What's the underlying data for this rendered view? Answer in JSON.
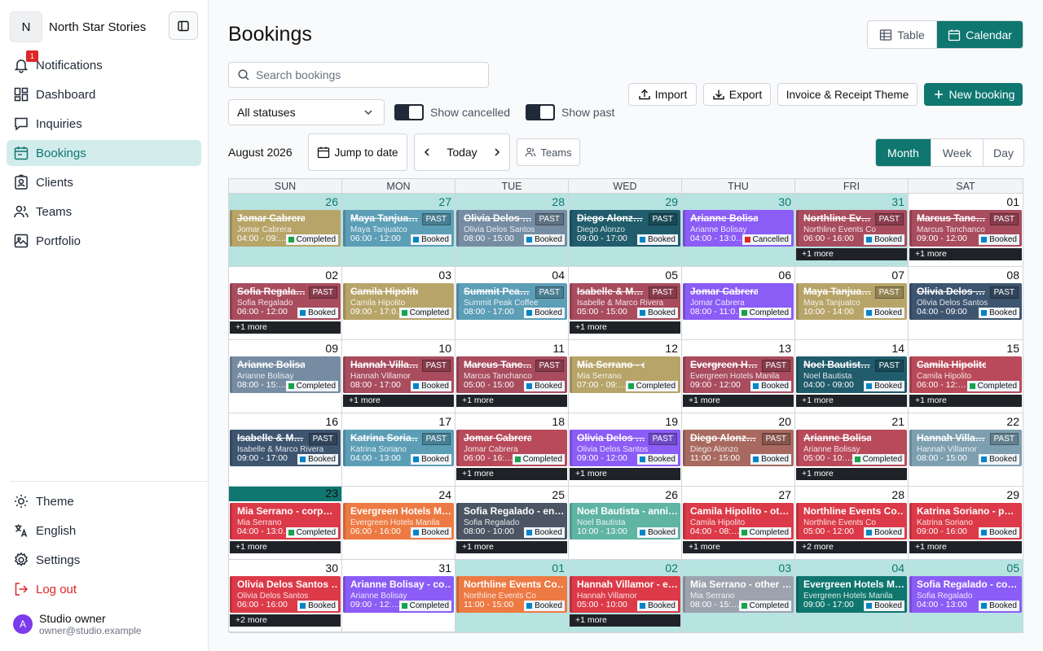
{
  "sidebar": {
    "brand_initial": "N",
    "brand_name": "North Star Stories",
    "notif_badge": "1",
    "items": [
      {
        "label": "Notifications",
        "icon": "bell-icon"
      },
      {
        "label": "Dashboard",
        "icon": "dashboard-icon"
      },
      {
        "label": "Inquiries",
        "icon": "chat-icon"
      },
      {
        "label": "Bookings",
        "icon": "calendar-icon"
      },
      {
        "label": "Clients",
        "icon": "clients-icon"
      },
      {
        "label": "Teams",
        "icon": "users-icon"
      },
      {
        "label": "Portfolio",
        "icon": "image-icon"
      }
    ],
    "theme": "Theme",
    "language": "English",
    "settings": "Settings",
    "logout": "Log out",
    "user": {
      "initial": "A",
      "name": "Studio owner",
      "email": "owner@studio.example"
    }
  },
  "header": {
    "title": "Bookings",
    "table": "Table",
    "calendar": "Calendar"
  },
  "toolbar": {
    "search_placeholder": "Search bookings",
    "status": "All statuses",
    "show_cancelled": "Show cancelled",
    "show_past": "Show past",
    "import": "Import",
    "export": "Export",
    "invoice_theme": "Invoice & Receipt Theme",
    "new_booking": "New booking"
  },
  "calnav": {
    "month_label": "August 2026",
    "jump": "Jump to date",
    "today": "Today",
    "teams": "Teams",
    "views": [
      "Month",
      "Week",
      "Day"
    ]
  },
  "colors": {
    "accent": "#0f7670",
    "booked": "#0284c7",
    "completed": "#16a34a",
    "cancelled": "#dc2626"
  },
  "calendar": {
    "dow": [
      "SUN",
      "MON",
      "TUE",
      "WED",
      "THU",
      "FRI",
      "SAT"
    ],
    "weeks": [
      [
        {
          "d": "26",
          "m": 1,
          "ev": {
            "t": "Jomar Cabrera - en…",
            "s": "Jomar Cabrera",
            "tm": "04:00 - 09:…",
            "st": "Completed",
            "c": "#b7a468",
            "past": 1
          }
        },
        {
          "d": "27",
          "m": 1,
          "ev": {
            "t": "Maya Tanjua…",
            "s": "Maya Tanjuatco",
            "tm": "06:00 - 12:00",
            "st": "Booked",
            "c": "#5c9eb6",
            "past": 1,
            "pb": 1
          }
        },
        {
          "d": "28",
          "m": 1,
          "ev": {
            "t": "Olivia Delos …",
            "s": "Olivia Delos Santos",
            "tm": "08:00 - 15:00",
            "st": "Booked",
            "c": "#768ca2",
            "past": 1,
            "pb": 1
          }
        },
        {
          "d": "29",
          "m": 1,
          "ev": {
            "t": "Diego Alonz…",
            "s": "Diego Alonzo",
            "tm": "09:00 - 17:00",
            "st": "Booked",
            "c": "#205c6b",
            "past": 1,
            "pb": 1
          }
        },
        {
          "d": "30",
          "m": 1,
          "ev": {
            "t": "Arianne Bolisay - co…",
            "s": "Arianne Bolisay",
            "tm": "04:00 - 13:0…",
            "st": "Cancelled",
            "c": "#8b5cf6",
            "past": 1
          }
        },
        {
          "d": "31",
          "m": 1,
          "ev": {
            "t": "Northline Ev…",
            "s": "Northline Events Co",
            "tm": "06:00 - 16:00",
            "st": "Booked",
            "c": "#a84c5e",
            "past": 1,
            "pb": 1
          },
          "more": "+1 more"
        },
        {
          "d": "01",
          "ev": {
            "t": "Marcus Tanc…",
            "s": "Marcus Tanchanco",
            "tm": "09:00 - 12:00",
            "st": "Booked",
            "c": "#a84c5e",
            "past": 1,
            "pb": 1
          },
          "more": "+1 more"
        }
      ],
      [
        {
          "d": "02",
          "ev": {
            "t": "Sofia Regala…",
            "s": "Sofia Regalado",
            "tm": "06:00 - 12:00",
            "st": "Booked",
            "c": "#a84c5e",
            "past": 1,
            "pb": 1
          },
          "more": "+1 more"
        },
        {
          "d": "03",
          "ev": {
            "t": "Camila Hipolito - en…",
            "s": "Camila Hipolito",
            "tm": "09:00 - 17:0…",
            "st": "Completed",
            "c": "#b7a468",
            "past": 1
          }
        },
        {
          "d": "04",
          "ev": {
            "t": "Summit Pea…",
            "s": "Summit Peak Coffee",
            "tm": "08:00 - 17:00",
            "st": "Booked",
            "c": "#5c9eb6",
            "past": 1,
            "pb": 1
          }
        },
        {
          "d": "05",
          "ev": {
            "t": "Isabelle & M…",
            "s": "Isabelle & Marco Rivera",
            "tm": "05:00 - 15:00",
            "st": "Booked",
            "c": "#a84c5e",
            "past": 1,
            "pb": 1
          },
          "more": "+1 more"
        },
        {
          "d": "06",
          "ev": {
            "t": "Jomar Cabrera - co…",
            "s": "Jomar Cabrera",
            "tm": "08:00 - 11:0…",
            "st": "Completed",
            "c": "#8b5cf6",
            "past": 1
          }
        },
        {
          "d": "07",
          "ev": {
            "t": "Maya Tanjua…",
            "s": "Maya Tanjuatco",
            "tm": "10:00 - 14:00",
            "st": "Booked",
            "c": "#b7a468",
            "past": 1,
            "pb": 1
          }
        },
        {
          "d": "08",
          "ev": {
            "t": "Olivia Delos …",
            "s": "Olivia Delos Santos",
            "tm": "04:00 - 09:00",
            "st": "Booked",
            "c": "#3e5570",
            "past": 1,
            "pb": 1
          }
        }
      ],
      [
        {
          "d": "09",
          "ev": {
            "t": "Arianne Bolisay - ot…",
            "s": "Arianne Bolisay",
            "tm": "08:00 - 15:…",
            "st": "Completed",
            "c": "#768ca2",
            "past": 1
          }
        },
        {
          "d": "10",
          "ev": {
            "t": "Hannah Villa…",
            "s": "Hannah Villamor",
            "tm": "08:00 - 17:00",
            "st": "Booked",
            "c": "#a84c5e",
            "past": 1,
            "pb": 1
          },
          "more": "+1 more"
        },
        {
          "d": "11",
          "ev": {
            "t": "Marcus Tanc…",
            "s": "Marcus Tanchanco",
            "tm": "05:00 - 15:00",
            "st": "Booked",
            "c": "#a84c5e",
            "past": 1,
            "pb": 1
          },
          "more": "+1 more"
        },
        {
          "d": "12",
          "ev": {
            "t": "Mia Serrano - enga…",
            "s": "Mia Serrano",
            "tm": "07:00 - 09:…",
            "st": "Completed",
            "c": "#b7a468",
            "past": 1
          }
        },
        {
          "d": "13",
          "ev": {
            "t": "Evergreen H…",
            "s": "Evergreen Hotels Manila",
            "tm": "09:00 - 12:00",
            "st": "Booked",
            "c": "#a84c5e",
            "past": 1,
            "pb": 1
          },
          "more": "+1 more"
        },
        {
          "d": "14",
          "ev": {
            "t": "Noel Bautist…",
            "s": "Noel Bautista",
            "tm": "04:00 - 09:00",
            "st": "Booked",
            "c": "#205c6b",
            "past": 1,
            "pb": 1
          },
          "more": "+1 more"
        },
        {
          "d": "15",
          "ev": {
            "t": "Camila Hipolito - c…",
            "s": "Camila Hipolito",
            "tm": "06:00 - 12:…",
            "st": "Completed",
            "c": "#b84a5a",
            "past": 1
          },
          "more": "+1 more"
        }
      ],
      [
        {
          "d": "16",
          "ev": {
            "t": "Isabelle & M…",
            "s": "Isabelle & Marco Rivera",
            "tm": "09:00 - 17:00",
            "st": "Booked",
            "c": "#3e5570",
            "past": 1,
            "pb": 1
          }
        },
        {
          "d": "17",
          "ev": {
            "t": "Katrina Soria…",
            "s": "Katrina Soriano",
            "tm": "04:00 - 13:00",
            "st": "Booked",
            "c": "#5c9eb6",
            "past": 1,
            "pb": 1
          }
        },
        {
          "d": "18",
          "ev": {
            "t": "Jomar Cabrera - ot…",
            "s": "Jomar Cabrera",
            "tm": "06:00 - 16:…",
            "st": "Completed",
            "c": "#b84a5a",
            "past": 1
          },
          "more": "+1 more"
        },
        {
          "d": "19",
          "ev": {
            "t": "Olivia Delos …",
            "s": "Olivia Delos Santos",
            "tm": "09:00 - 12:00",
            "st": "Booked",
            "c": "#8b5cf6",
            "past": 1,
            "pb": 1
          },
          "more": "+1 more"
        },
        {
          "d": "20",
          "ev": {
            "t": "Diego Alonz…",
            "s": "Diego Alonzo",
            "tm": "11:00 - 15:00",
            "st": "Booked",
            "c": "#a86a60",
            "past": 1,
            "pb": 1
          }
        },
        {
          "d": "21",
          "ev": {
            "t": "Arianne Bolisay - en…",
            "s": "Arianne Bolisay",
            "tm": "05:00 - 10:…",
            "st": "Completed",
            "c": "#b84a5a",
            "past": 1
          },
          "more": "+1 more"
        },
        {
          "d": "22",
          "ev": {
            "t": "Hannah Villa…",
            "s": "Hannah Villamor",
            "tm": "08:00 - 15:00",
            "st": "Booked",
            "c": "#7d9fb0",
            "past": 1,
            "pb": 1
          }
        }
      ],
      [
        {
          "d": "23",
          "today": 1,
          "ev": {
            "t": "Mia Serrano - corp…",
            "s": "Mia Serrano",
            "tm": "04:00 - 13:0…",
            "st": "Completed",
            "c": "#dc3a48"
          },
          "more": "+1 more"
        },
        {
          "d": "24",
          "ev": {
            "t": "Evergreen Hotels M…",
            "s": "Evergreen Hotels Manila",
            "tm": "06:00 - 16:00",
            "st": "Booked",
            "c": "#ed7a43"
          }
        },
        {
          "d": "25",
          "ev": {
            "t": "Sofia Regalado - en…",
            "s": "Sofia Regalado",
            "tm": "08:00 - 10:00",
            "st": "Booked",
            "c": "#4b5563"
          },
          "more": "+1 more"
        },
        {
          "d": "26",
          "ev": {
            "t": "Noel Bautista - anni…",
            "s": "Noel Bautista",
            "tm": "10:00 - 13:00",
            "st": "Booked",
            "c": "#5fb4a4"
          }
        },
        {
          "d": "27",
          "ev": {
            "t": "Camila Hipolito - ot…",
            "s": "Camila Hipolito",
            "tm": "04:00 - 08:…",
            "st": "Completed",
            "c": "#dc3a48"
          },
          "more": "+1 more"
        },
        {
          "d": "28",
          "ev": {
            "t": "Northline Events Co…",
            "s": "Northline Events Co",
            "tm": "05:00 - 12:00",
            "st": "Booked",
            "c": "#dc3a48"
          },
          "more": "+2 more"
        },
        {
          "d": "29",
          "ev": {
            "t": "Katrina Soriano - p…",
            "s": "Katrina Soriano",
            "tm": "09:00 - 16:00",
            "st": "Booked",
            "c": "#dc3a48"
          },
          "more": "+1 more"
        }
      ],
      [
        {
          "d": "30",
          "ev": {
            "t": "Olivia Delos Santos …",
            "s": "Olivia Delos Santos",
            "tm": "06:00 - 16:00",
            "st": "Booked",
            "c": "#dc3a48"
          },
          "more": "+2 more"
        },
        {
          "d": "31",
          "ev": {
            "t": "Arianne Bolisay - co…",
            "s": "Arianne Bolisay",
            "tm": "09:00 - 12:…",
            "st": "Completed",
            "c": "#8b5cf6"
          }
        },
        {
          "d": "01",
          "m": 1,
          "ev": {
            "t": "Northline Events Co…",
            "s": "Northline Events Co",
            "tm": "11:00 - 15:00",
            "st": "Booked",
            "c": "#ed7a43"
          }
        },
        {
          "d": "02",
          "m": 1,
          "ev": {
            "t": "Hannah Villamor - e…",
            "s": "Hannah Villamor",
            "tm": "05:00 - 10:00",
            "st": "Booked",
            "c": "#dc3a48"
          },
          "more": "+1 more"
        },
        {
          "d": "03",
          "m": 1,
          "ev": {
            "t": "Mia Serrano - other …",
            "s": "Mia Serrano",
            "tm": "08:00 - 15:…",
            "st": "Completed",
            "c": "#9ca3af"
          }
        },
        {
          "d": "04",
          "m": 1,
          "ev": {
            "t": "Evergreen Hotels M…",
            "s": "Evergreen Hotels Manila",
            "tm": "09:00 - 17:00",
            "st": "Booked",
            "c": "#0f766e"
          }
        },
        {
          "d": "05",
          "m": 1,
          "ev": {
            "t": "Sofia Regalado - co…",
            "s": "Sofia Regalado",
            "tm": "04:00 - 13:00",
            "st": "Booked",
            "c": "#8b5cf6"
          }
        }
      ]
    ]
  }
}
